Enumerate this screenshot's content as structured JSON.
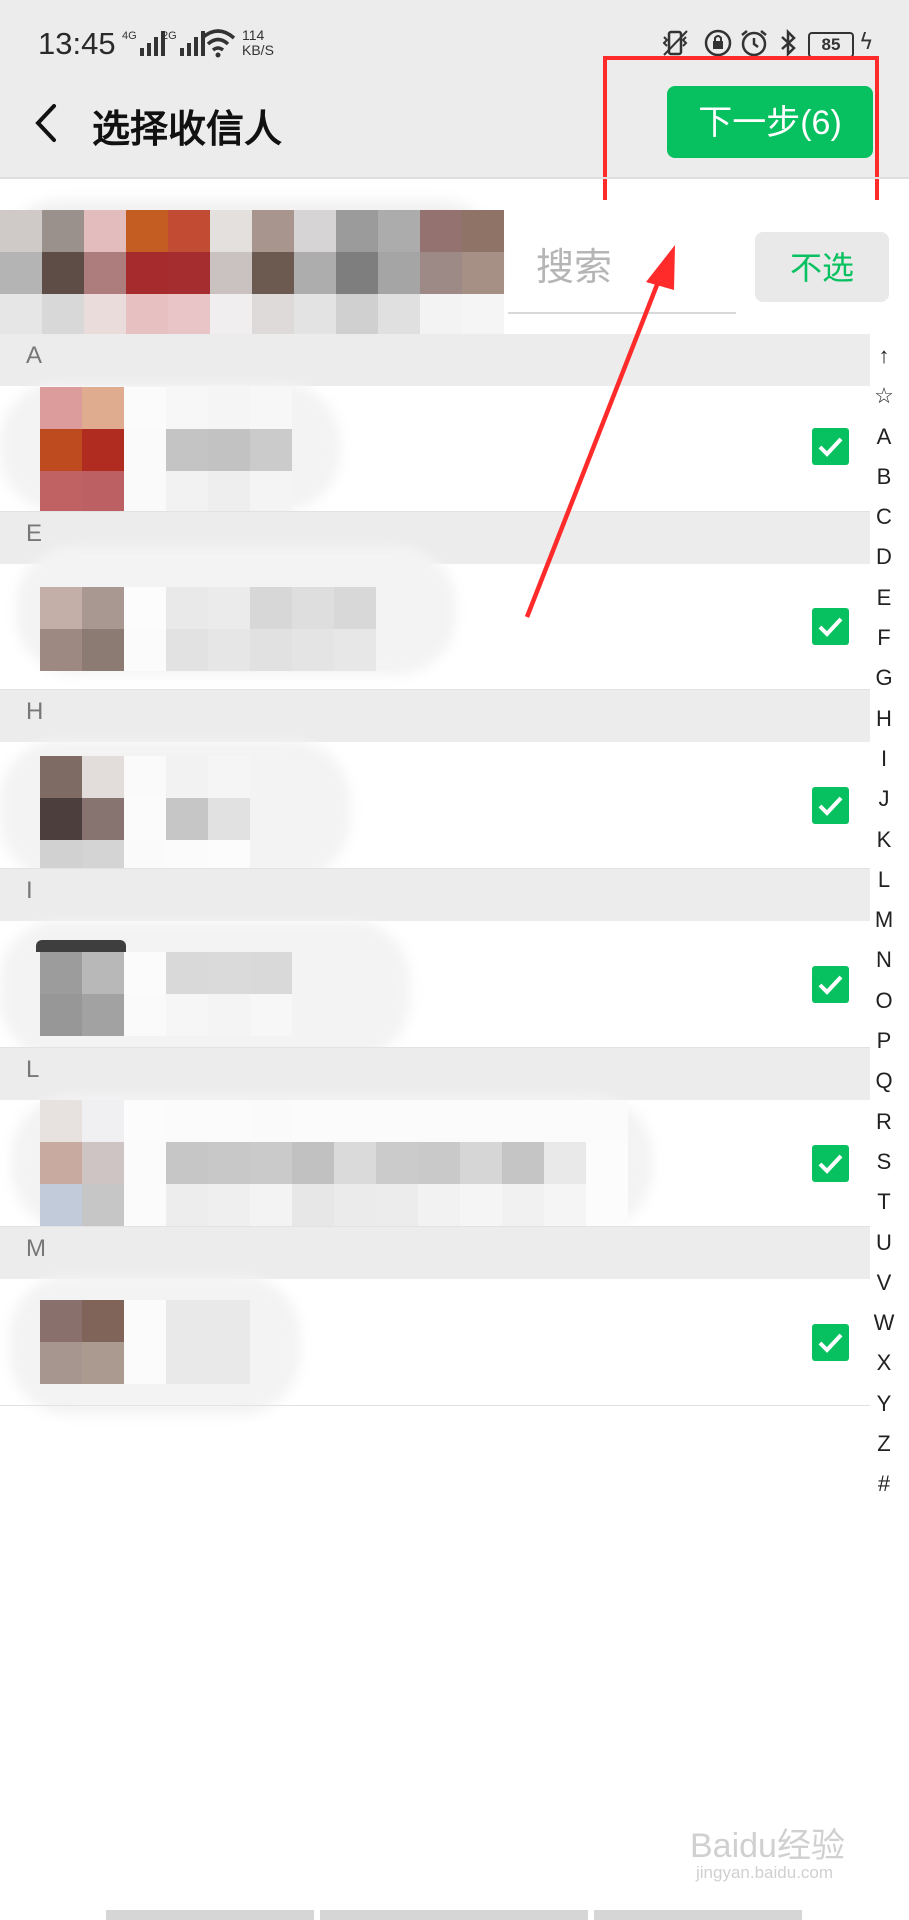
{
  "status_bar": {
    "time": "13:45",
    "sim1": "4G",
    "sim2": "2G",
    "speed_value": "114",
    "speed_unit": "KB/S",
    "battery": "85"
  },
  "header": {
    "title": "选择收信人",
    "next_label": "下一步(6)"
  },
  "search": {
    "placeholder": "搜索",
    "unselect_label": "不选"
  },
  "sections": [
    "A",
    "E",
    "H",
    "I",
    "L",
    "M"
  ],
  "index_letters": [
    "↑",
    "☆",
    "A",
    "B",
    "C",
    "D",
    "E",
    "F",
    "G",
    "H",
    "I",
    "J",
    "K",
    "L",
    "M",
    "N",
    "O",
    "P",
    "Q",
    "R",
    "S",
    "T",
    "U",
    "V",
    "W",
    "X",
    "Y",
    "Z",
    "#"
  ],
  "colors": {
    "accent": "#07c160",
    "annotation": "#ff2a2a"
  },
  "watermark": {
    "brand": "Baidu经验",
    "url": "jingyan.baidu.com"
  }
}
